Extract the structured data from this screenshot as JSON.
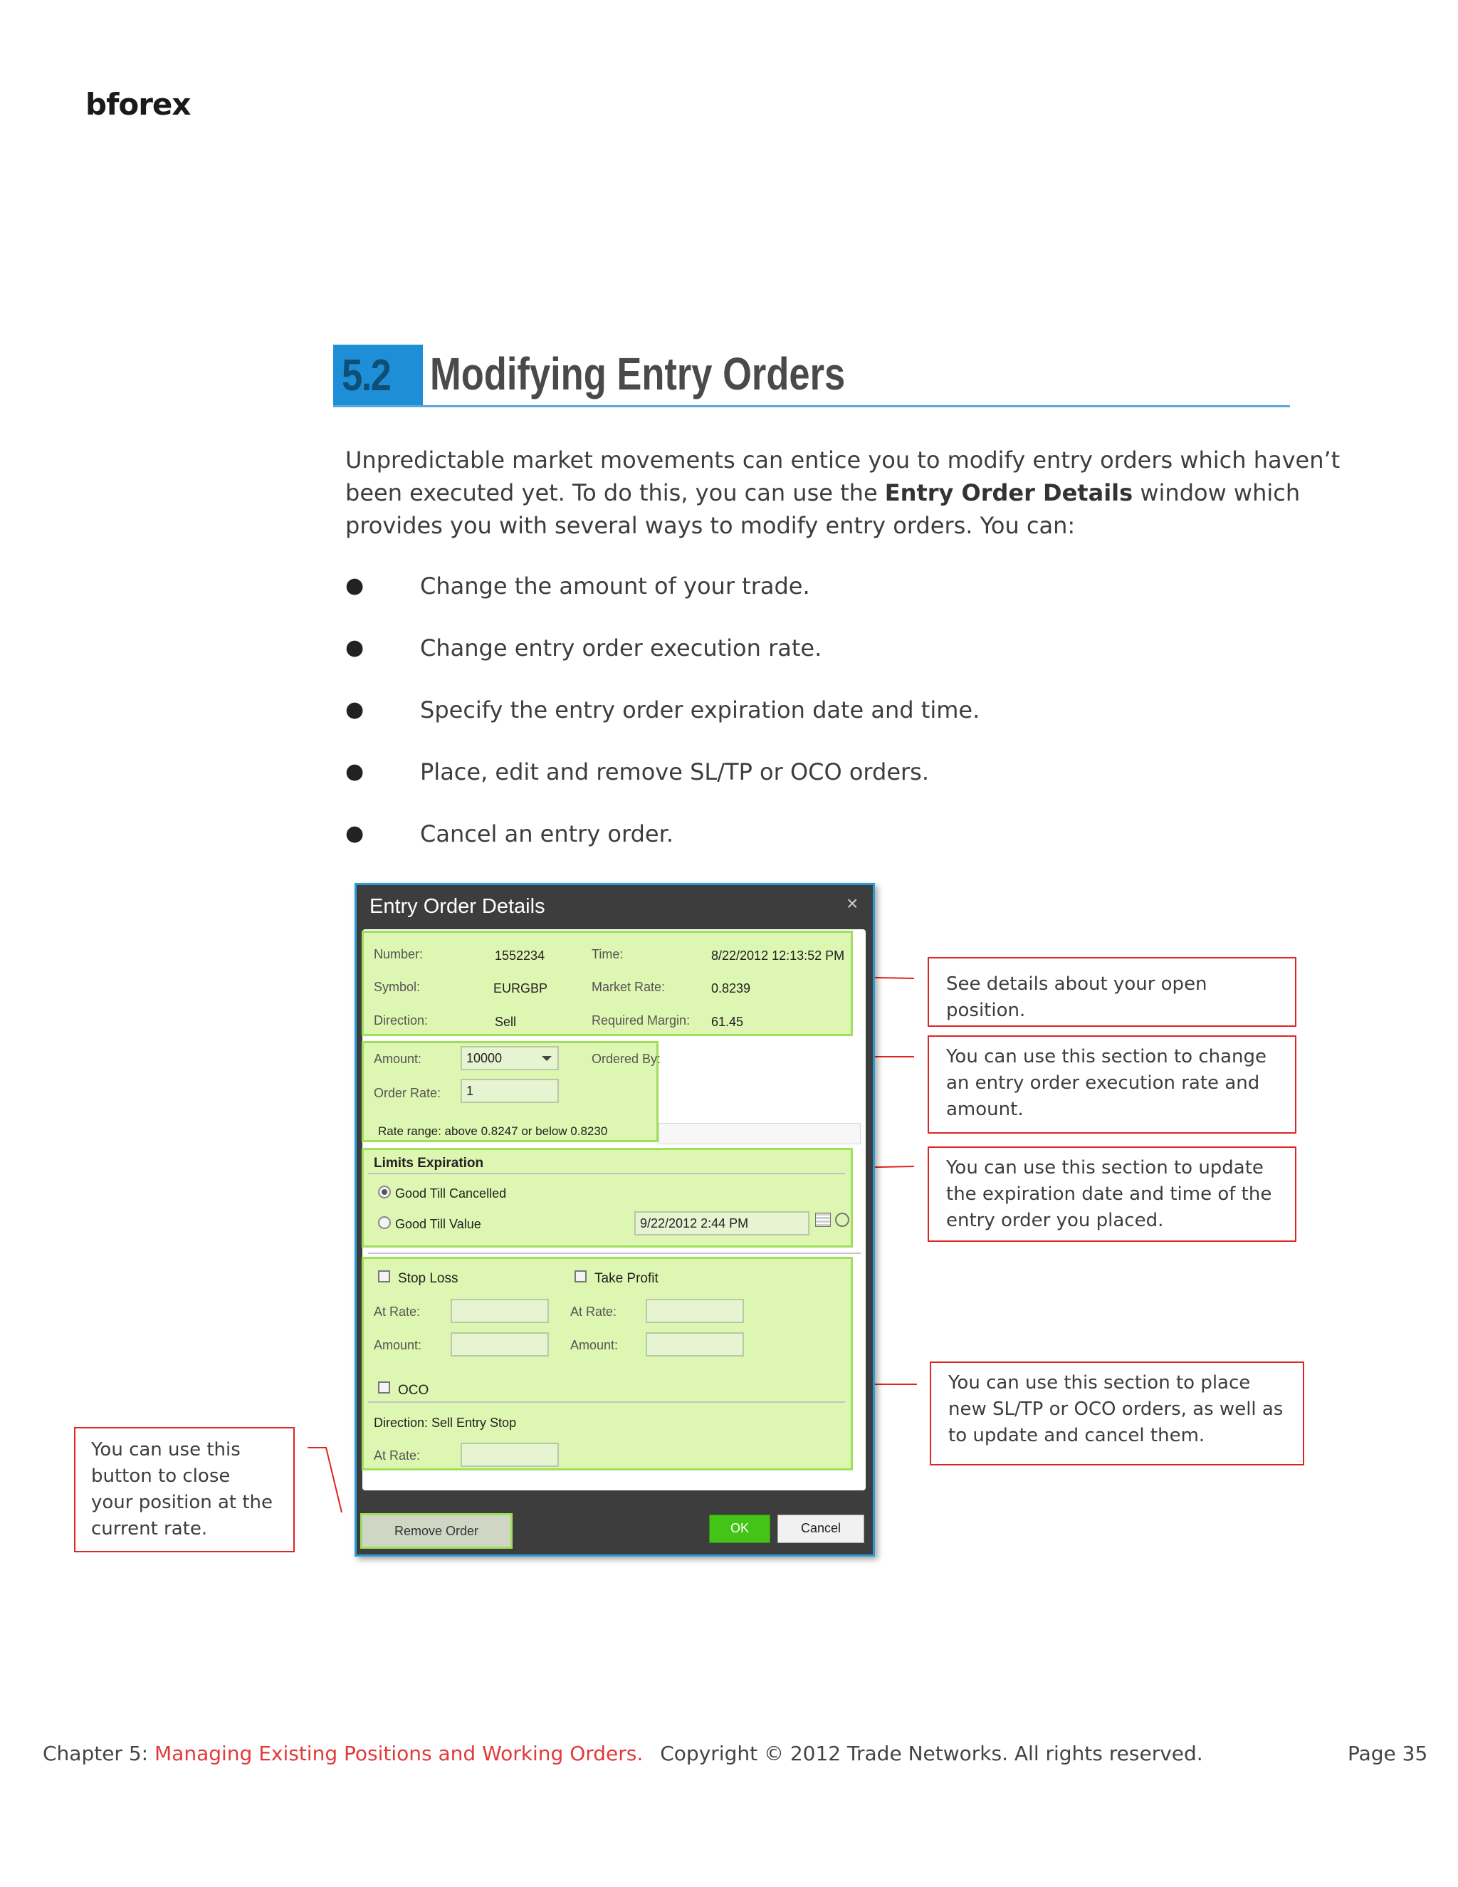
{
  "logo": {
    "text": "bforex"
  },
  "section": {
    "number": "5.2",
    "title": "Modifying Entry Orders"
  },
  "intro": {
    "before": "Unpredictable market movements can entice you to modify entry orders which haven’t been executed yet. To do this, you can use the ",
    "bold": "Entry Order Details",
    "after": " window which provides you with several ways to modify entry orders. You can:"
  },
  "bullets": [
    "Change the amount of your trade.",
    "Change entry order execution rate.",
    "Specify the entry order expiration date and time.",
    "Place, edit and remove SL/TP or OCO orders.",
    "Cancel an entry order."
  ],
  "dialog": {
    "title": "Entry Order Details",
    "close": "×",
    "details": {
      "number_label": "Number:",
      "number": "1552234",
      "time_label": "Time:",
      "time": "8/22/2012 12:13:52 PM",
      "symbol_label": "Symbol:",
      "symbol": "EURGBP",
      "market_rate_label": "Market Rate:",
      "market_rate": "0.8239",
      "direction_label": "Direction:",
      "direction": "Sell",
      "margin_label": "Required Margin:",
      "margin": "61.45"
    },
    "order": {
      "amount_label": "Amount:",
      "amount": "10000",
      "ordered_by_label": "Ordered By:",
      "rate_label": "Order Rate:",
      "rate": "1",
      "rate_range": "Rate range: above 0.8247 or below 0.8230"
    },
    "expiration": {
      "header": "Limits Expiration",
      "gtc": "Good Till Cancelled",
      "gtv": "Good Till Value",
      "date": "9/22/2012 2:44 PM"
    },
    "limits": {
      "stop_loss": "Stop Loss",
      "take_profit": "Take Profit",
      "at_rate": "At Rate:",
      "amount": "Amount:",
      "oco": "OCO",
      "oco_direction": "Direction: Sell Entry Stop"
    },
    "buttons": {
      "remove": "Remove Order",
      "ok": "OK",
      "cancel": "Cancel"
    }
  },
  "callouts": {
    "details": "See details about your open position.",
    "rate": "You can use this section to change an entry order execution rate and amount.",
    "expiration": "You can use this section to update the expiration date and time of the entry order you placed.",
    "sltp": "You can use this section to place new SL/TP or OCO orders, as well as to update and cancel them.",
    "remove": "You can use this button to close your position at the current rate."
  },
  "footer": {
    "chapter_prefix": "Chapter 5: ",
    "chapter_title": "Managing Existing Positions and Working Orders.",
    "copyright": "Copyright © 2012 Trade Networks. All rights reserved.",
    "page": "Page 35"
  }
}
